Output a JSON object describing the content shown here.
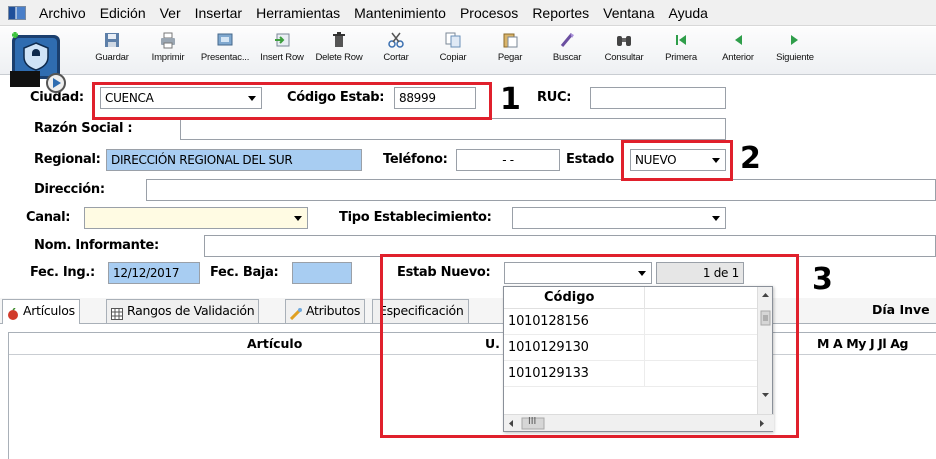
{
  "menu": {
    "items": [
      "Archivo",
      "Edición",
      "Ver",
      "Insertar",
      "Herramientas",
      "Mantenimiento",
      "Procesos",
      "Reportes",
      "Ventana",
      "Ayuda"
    ]
  },
  "toolbar": {
    "buttons": [
      {
        "label": "Guardar",
        "icon": "save-icon"
      },
      {
        "label": "Imprimir",
        "icon": "printer-icon"
      },
      {
        "label": "Presentac...",
        "icon": "presentation-icon"
      },
      {
        "label": "Insert Row",
        "icon": "insert-row-icon"
      },
      {
        "label": "Delete Row",
        "icon": "delete-row-icon"
      },
      {
        "label": "Cortar",
        "icon": "scissors-icon"
      },
      {
        "label": "Copiar",
        "icon": "copy-icon"
      },
      {
        "label": "Pegar",
        "icon": "paste-icon"
      },
      {
        "label": "Buscar",
        "icon": "search-icon"
      },
      {
        "label": "Consultar",
        "icon": "binoculars-icon"
      },
      {
        "label": "Primera",
        "icon": "first-record-icon"
      },
      {
        "label": "Anterior",
        "icon": "previous-record-icon"
      },
      {
        "label": "Siguiente",
        "icon": "next-record-icon"
      }
    ]
  },
  "form": {
    "ciudad_label": "Ciudad:",
    "ciudad_value": "CUENCA",
    "codigo_estab_label": "Código Estab:",
    "codigo_estab_value": "88999",
    "ruc_label": "RUC:",
    "ruc_value": "",
    "razon_social_label": "Razón Social :",
    "razon_social_value": "",
    "regional_label": "Regional:",
    "regional_value": "DIRECCIÓN REGIONAL DEL SUR",
    "telefono_label": "Teléfono:",
    "telefono_value": " -  - ",
    "estado_label": "Estado",
    "estado_value": "NUEVO",
    "direccion_label": "Dirección:",
    "direccion_value": "",
    "canal_label": "Canal:",
    "canal_value": "",
    "tipo_estab_label": "Tipo Establecimiento:",
    "tipo_estab_value": "",
    "nom_informante_label": "Nom. Informante:",
    "nom_informante_value": "",
    "fec_ing_label": "Fec. Ing.:",
    "fec_ing_value": "12/12/2017",
    "fec_baja_label": "Fec. Baja:",
    "fec_baja_value": "",
    "estab_nuevo_label": "Estab Nuevo:",
    "estab_nuevo_value": "",
    "record_counter": "1 de 1"
  },
  "annotations": [
    "1",
    "2",
    "3"
  ],
  "tabs": [
    {
      "label": "Artículos",
      "icon": "apple-icon"
    },
    {
      "label": "Rangos de Validación",
      "icon": "grid-icon"
    },
    {
      "label": "Atributos",
      "icon": "attributes-icon"
    },
    {
      "label": "Especificación",
      "icon": ""
    }
  ],
  "tab_right_title": "Día Inve",
  "grid": {
    "col_articulo": "Artículo",
    "col_u": "U.",
    "days_header": "M  A  My  J  Jl  Ag"
  },
  "estab_dropdown": {
    "column_header": "Código",
    "rows": [
      "1010128156",
      "1010129130",
      "1010129133"
    ],
    "hscroll_thumb": "III"
  },
  "colors": {
    "annotation_red": "#e0202c",
    "highlight_blue": "#a8cdf2",
    "canal_yellow": "#fffbe3"
  }
}
